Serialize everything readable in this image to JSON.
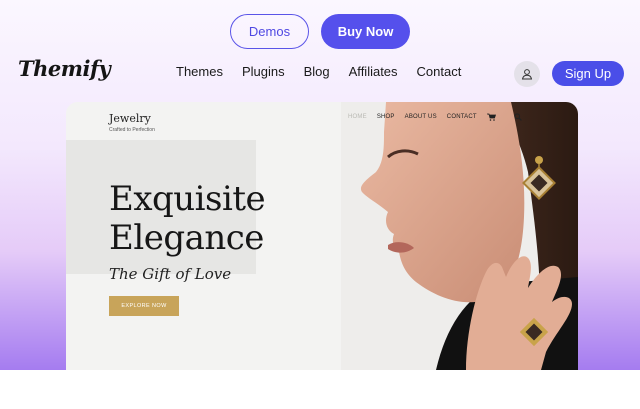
{
  "header": {
    "demos_label": "Demos",
    "buy_label": "Buy Now",
    "logo": "Themify",
    "nav": [
      "Themes",
      "Plugins",
      "Blog",
      "Affiliates",
      "Contact"
    ],
    "signup_label": "Sign Up",
    "user_icon": "user-icon"
  },
  "preview": {
    "site_title": "Jewelry",
    "site_tagline": "Crafted to Perfection",
    "nav": [
      "HOME",
      "SHOP",
      "ABOUT US",
      "CONTACT"
    ],
    "cart_icon": "cart-icon",
    "search_icon": "search-icon",
    "hero_line1": "Exquisite",
    "hero_line2": "Elegance",
    "hero_sub": "The Gift of Love",
    "cta_label": "EXPLORE NOW"
  },
  "colors": {
    "accent": "#5550ec",
    "gold": "#c8a45a",
    "gradient_bottom": "#a57cf0"
  }
}
